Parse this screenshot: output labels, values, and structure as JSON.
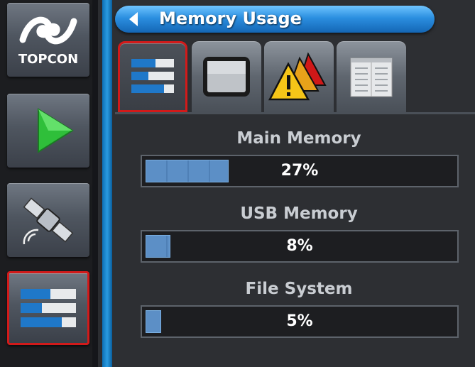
{
  "sidebar": {
    "logo_text": "TOPCON",
    "items": [
      {
        "name": "topcon-logo",
        "icon": "topcon-logo-icon"
      },
      {
        "name": "run-screen",
        "icon": "green-play-icon"
      },
      {
        "name": "gnss-satellite",
        "icon": "satellite-icon"
      },
      {
        "name": "memory-usage",
        "icon": "bar-list-icon",
        "selected": true
      }
    ]
  },
  "header": {
    "title": "Memory Usage"
  },
  "tabs": [
    {
      "name": "memory-tab",
      "icon": "bar-list-icon",
      "active": true
    },
    {
      "name": "display-tab",
      "icon": "monitor-icon"
    },
    {
      "name": "alarms-tab",
      "icon": "warning-triangles-icon"
    },
    {
      "name": "log-tab",
      "icon": "document-list-icon"
    }
  ],
  "memory": {
    "main": {
      "label": "Main Memory",
      "percent_text": "27%",
      "fraction": 0.27
    },
    "usb": {
      "label": "USB Memory",
      "percent_text": "8%",
      "fraction": 0.08
    },
    "filesystem": {
      "label": "File System",
      "percent_text": "5%",
      "fraction": 0.05
    }
  },
  "colors": {
    "accent_blue": "#2b8fe0",
    "selection_red": "#d21a1a",
    "bar_fill": "#5c8fc6"
  }
}
